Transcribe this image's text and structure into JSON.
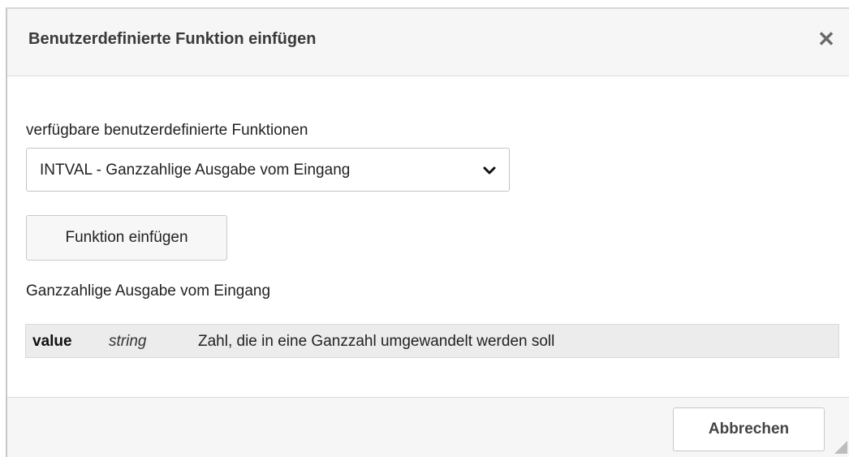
{
  "dialog": {
    "title": "Benutzerdefinierte Funktion einfügen",
    "close_label": "✕"
  },
  "functions": {
    "label": "verfügbare benutzerdefinierte Funktionen",
    "selected": "INTVAL - Ganzzahlige Ausgabe vom Eingang"
  },
  "insert_button": {
    "label": "Funktion einfügen"
  },
  "description": "Ganzzahlige Ausgabe vom Eingang",
  "params": [
    {
      "name": "value",
      "type": "string",
      "description": "Zahl, die in eine Ganzzahl umgewandelt werden soll"
    }
  ],
  "footer": {
    "cancel_label": "Abbrechen"
  },
  "icons": {
    "close": "close-icon",
    "dropdown": "chevron-down-icon",
    "resize": "resize-handle-icon"
  }
}
